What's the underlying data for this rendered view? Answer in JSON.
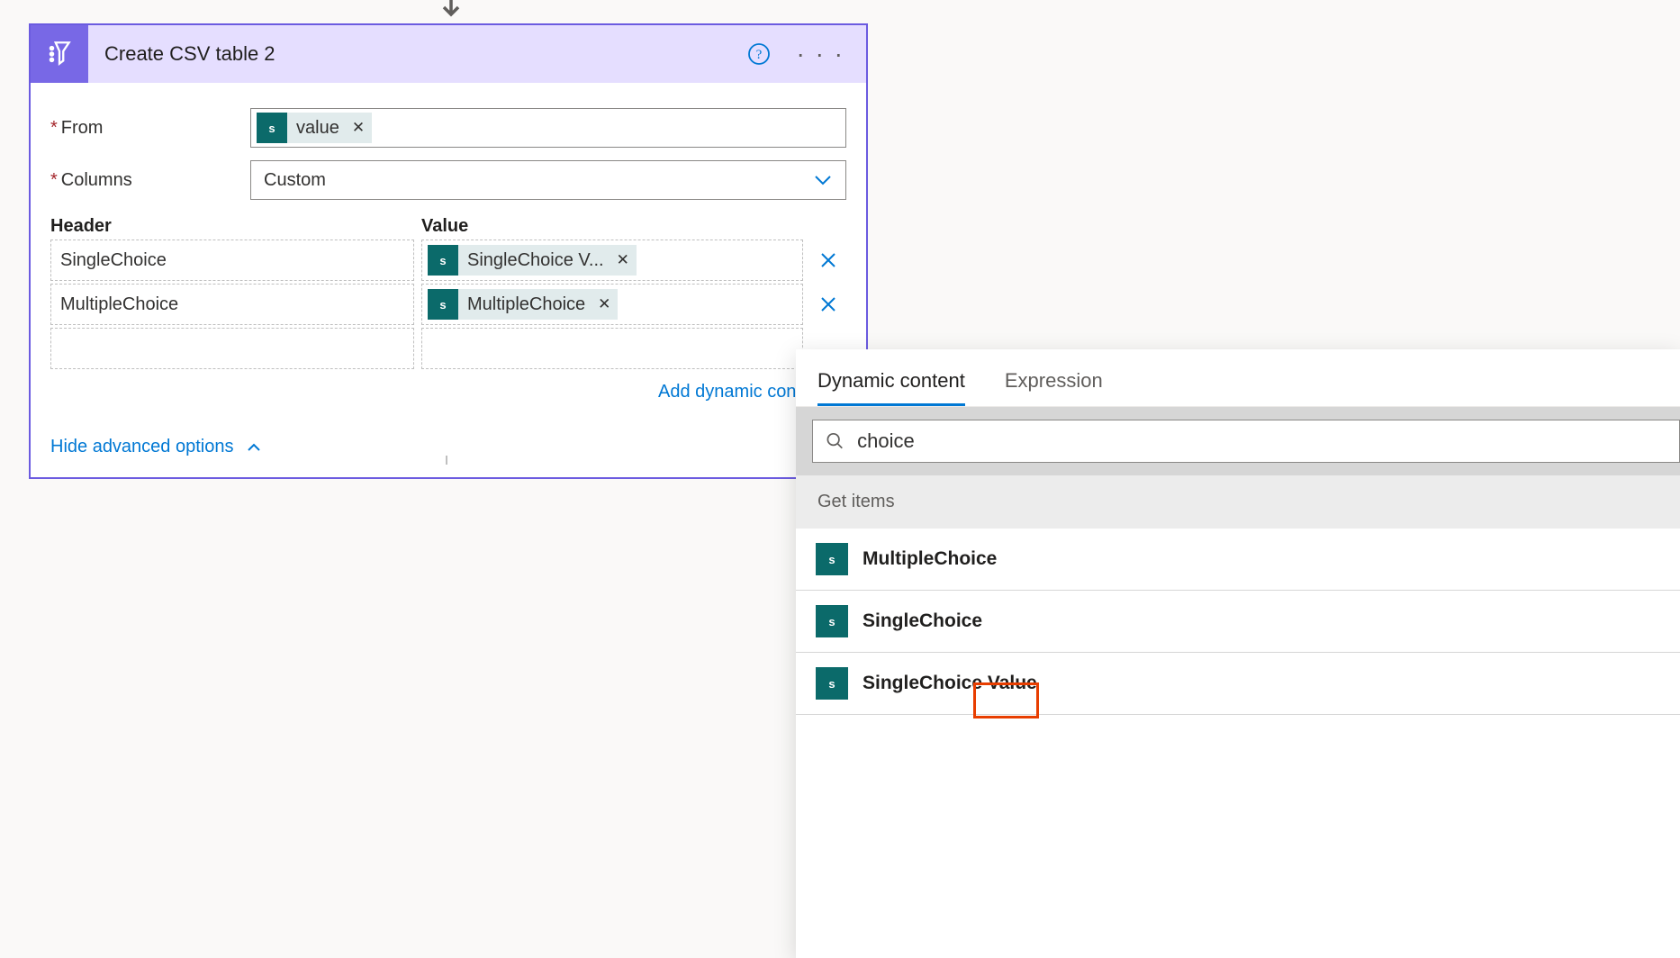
{
  "card": {
    "title": "Create CSV table 2",
    "fields": {
      "from_label": "From",
      "from_token": "value",
      "columns_label": "Columns",
      "columns_value": "Custom"
    },
    "table": {
      "header_label": "Header",
      "value_label": "Value",
      "rows": [
        {
          "header": "SingleChoice",
          "value_token": "SingleChoice V..."
        },
        {
          "header": "MultipleChoice",
          "value_token": "MultipleChoice"
        }
      ]
    },
    "add_dynamic_label": "Add dynamic cont",
    "hide_advanced_label": "Hide advanced options"
  },
  "dc": {
    "tabs": {
      "dynamic": "Dynamic content",
      "expression": "Expression"
    },
    "search_value": "choice",
    "section": "Get items",
    "items": [
      {
        "label": "MultipleChoice"
      },
      {
        "label": "SingleChoice"
      },
      {
        "label_prefix": "SingleChoice ",
        "label_highlight": "Value"
      }
    ]
  }
}
